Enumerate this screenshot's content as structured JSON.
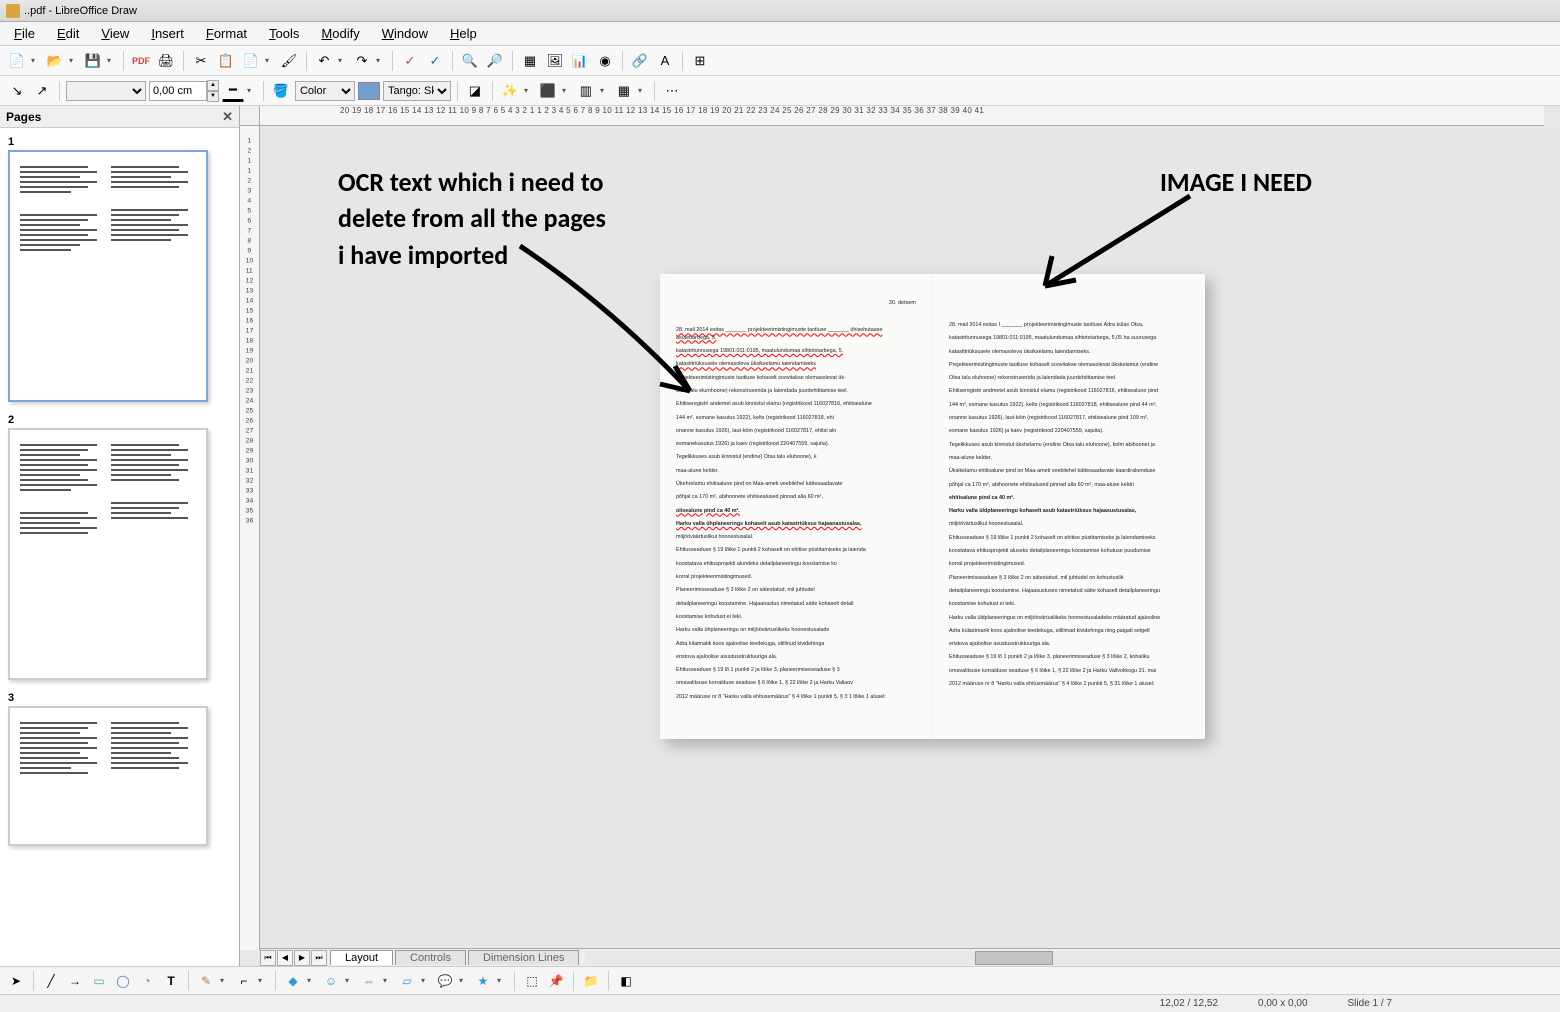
{
  "window": {
    "title": "..pdf - LibreOffice Draw"
  },
  "menus": [
    "File",
    "Edit",
    "View",
    "Insert",
    "Format",
    "Tools",
    "Modify",
    "Window",
    "Help"
  ],
  "toolbar2": {
    "line_width": "0,00 cm",
    "color_label": "Color",
    "palette": "Tango: Sk"
  },
  "pages_panel": {
    "title": "Pages",
    "thumbs": [
      "1",
      "2",
      "3"
    ]
  },
  "ruler_h": "20 19 18 17 16 15 14 13 12 11 10  9  8  7  6  5  4  3  2  1   1  2  3  4  5  6  7  8  9 10 11 12 13 14 15 16 17 18 19 20 21 22 23 24 25 26 27 28 29 30 31 32 33 34 35 36 37 38 39 40 41",
  "ruler_v": [
    "1",
    "2",
    "1",
    "1",
    "2",
    "3",
    "4",
    "5",
    "6",
    "7",
    "8",
    "9",
    "10",
    "11",
    "12",
    "13",
    "14",
    "15",
    "16",
    "17",
    "18",
    "19",
    "20",
    "21",
    "22",
    "23",
    "24",
    "25",
    "26",
    "27",
    "28",
    "29",
    "30",
    "31",
    "32",
    "33",
    "34",
    "35",
    "36"
  ],
  "annotations": {
    "left": "OCR text which i need to\ndelete from all the pages\ni have imported",
    "right": "IMAGE I NEED"
  },
  "document": {
    "date_left": "30. detsem",
    "left_paras": [
      "28. mail 2014 esitas _______ projekteerimistingimuste taotluse _______ ühisehutaase asutettarbega, 5.",
      "katastritunnusega 19801:011:0195, maatulundumaa sihtotstarbega, 5.",
      "katastitriüksusele olemasoleva üksikselamu laiendamiseks",
      "Projekteerimistingimuste taotluse kohaselt soovitakse olemasolevat ük-",
      "Otsa talu elumhoone) rekonstrueerida ja laiendada juurdehititamise teel.",
      "Ehitiseregistri andemel asub kinnistul elamu (registrikood 116027816, ehitisealune",
      "144 m², esmane kasutus 1922), kelts (registrikood 116027818, ehi",
      "onanne kasutus 1926), laut-köin (registrikood 116027817, ehitsi aln",
      "esmanekasutus 1926) ja kaev (registrikood 220407559, sajuita).",
      "Tegelikkuses asub kinnistul (endine) Otsa talu eluhoone), k",
      "maa-alune kelder.",
      "Ükehrelamu ehitisalune pind on Maa-ameti veebilehel kättesaadavate",
      "põhjal ca 170 m², abihoonete ehitisealused pinnad alla 60 m²,",
      "olisealune pind ca 40 m².",
      "Harku valla ühplaneerings kohaselt asub katastriüksus hajaanastusalas,",
      "miljööväärtuslikul hoonestusalal.",
      "Ehitusseaduse § 19 lõike 1 punkti 2 kohaselt on ehitise püstitamiseks ja laienda",
      "koostatava ehitusprojekti alundeks detailplaneeringu koostamise ko",
      "korral projekteerimistingimused.",
      "Planeerimisseaduse § 3 lõike 2 on sätestatud, mil juhtudel",
      "detailplaneeringu koostamine. Hajaanastus nimetatud sätte kohaselt detall",
      "koostamise kohutust ei teki.",
      "Harku valla ühplaneeringu on miljöövärtuslikeks hoonestusalade",
      "Adra kilatmatik koos ajaloolise teedekuga, stillinud kividehinga",
      "eristova ajaloolise asustusstruktuuriga ala.",
      "Ehitusseaduse § 19 lõ 1 punkti 2 ja lõike 3, planeerimiseseaduse § 3",
      "omavalitsuse korralduse seaduse § 6 lõike 1, § 22 lõike 2 ja Harku Vallaov",
      "2012 määruse nr 8 \"Harku valla ehitusemäärus\" § 4 lõike 1 punkti 5, § 3 1 lõike 1 alusel:"
    ],
    "right_paras": [
      "28. mail 2014 esitas I _______ projekteerimistingimuste taotluse Adra külas Otsa,",
      "katastritunnusega 19801:011:0195, maatulundumaa sihtotstarbega, 5,05 ha suurusega",
      "katastitriüksusele olemasoleva üksikselamu laiendamiseks.",
      "Projekteerimistingimuste taotluse kohaselt soovitakse olemasolevat ükskelamut (endine",
      "Otsa talu eluhoone) rekonstrueerida ja laiendada juurdehititamise teel.",
      "Ehitiseregistri andmetel asub kinnistul elamu (registrikood 116027816, ehitisealune pind",
      "144 m², esmane kasutus 1922), kelts (registrikood 116027818, ehitisealune pind 44 m²,",
      "onanne kasutus 1926), laut-köin (registrikood 116027817, ehitisealune pind 109 m²,",
      "esmane kasutus 1926) ja kaev (registrikood 220407559, sajuita).",
      "Tegelikkuses asub kinnistul ükshelamu (endine Otsa talu eluhoone), kolm abihoonet ja",
      "maa-alune kelder.",
      "Üksikelamu ehitisalune pind on Maa-ameti veebilehel kättesaadavate kaardirakenduse",
      "põhjal ca 170 m², abihoonete ehitisalused pinnad alla 60 m², maa-aluse keldri",
      "ehitisalune pind ca 40 m².",
      "Harku valla üldplaneeringu kohaselt asub katastriüksus hajaasustusalas,",
      "miljöövärtuslikul hoonestusalal.",
      "Ehitusseaduse § 19 lõike 1 punkti 2 kohaselt on ehitise püstitamiseks ja laiendamiseks",
      "koostatava ehitusprojekti aluseks detailplaneeringu koostamise kohutuse puudumise",
      "korral projekteerimistingimused.",
      "Planeerimisseaduse § 3 lõike 2 on sätestatud, mil juhtudel on kohustuslik",
      "detailplaneeringu koostamine. Hajaasustuses nimetatud sätte kohaselt detailplaneeringu",
      "koostamise kohutust ei teki.",
      "Harku valla üldplaneeringus on miljöövärtuslikeks hoonestusaladeks määratud ajalooline",
      "Adra külastmarik koos ajaloolise teedekuga, stillimad kividehinga ning paigati selgelt",
      "eristova ajaloolise asustusstruktuuriga ala.",
      "Ehitusseaduse § 19 lõ 1 punkti 2 ja lõike 3, planeerimisseaduse § 3 lõike 2, kohaliku",
      "omavalitsuse korralduse seaduse § 6 lõike 1, § 22 lõike 2 ja Harku Vallvolikogu 31. mai",
      "2012 määruse nr 8 \"Harku valla ehitusmäärus\" § 4 lõike 1 punkti 5, § 31 lõike 1 alusel:"
    ]
  },
  "tabs": [
    "Layout",
    "Controls",
    "Dimension Lines"
  ],
  "statusbar": {
    "pos": "12,02 / 12,52",
    "size": "0,00 x 0,00",
    "slide": "Slide 1 / 7"
  }
}
